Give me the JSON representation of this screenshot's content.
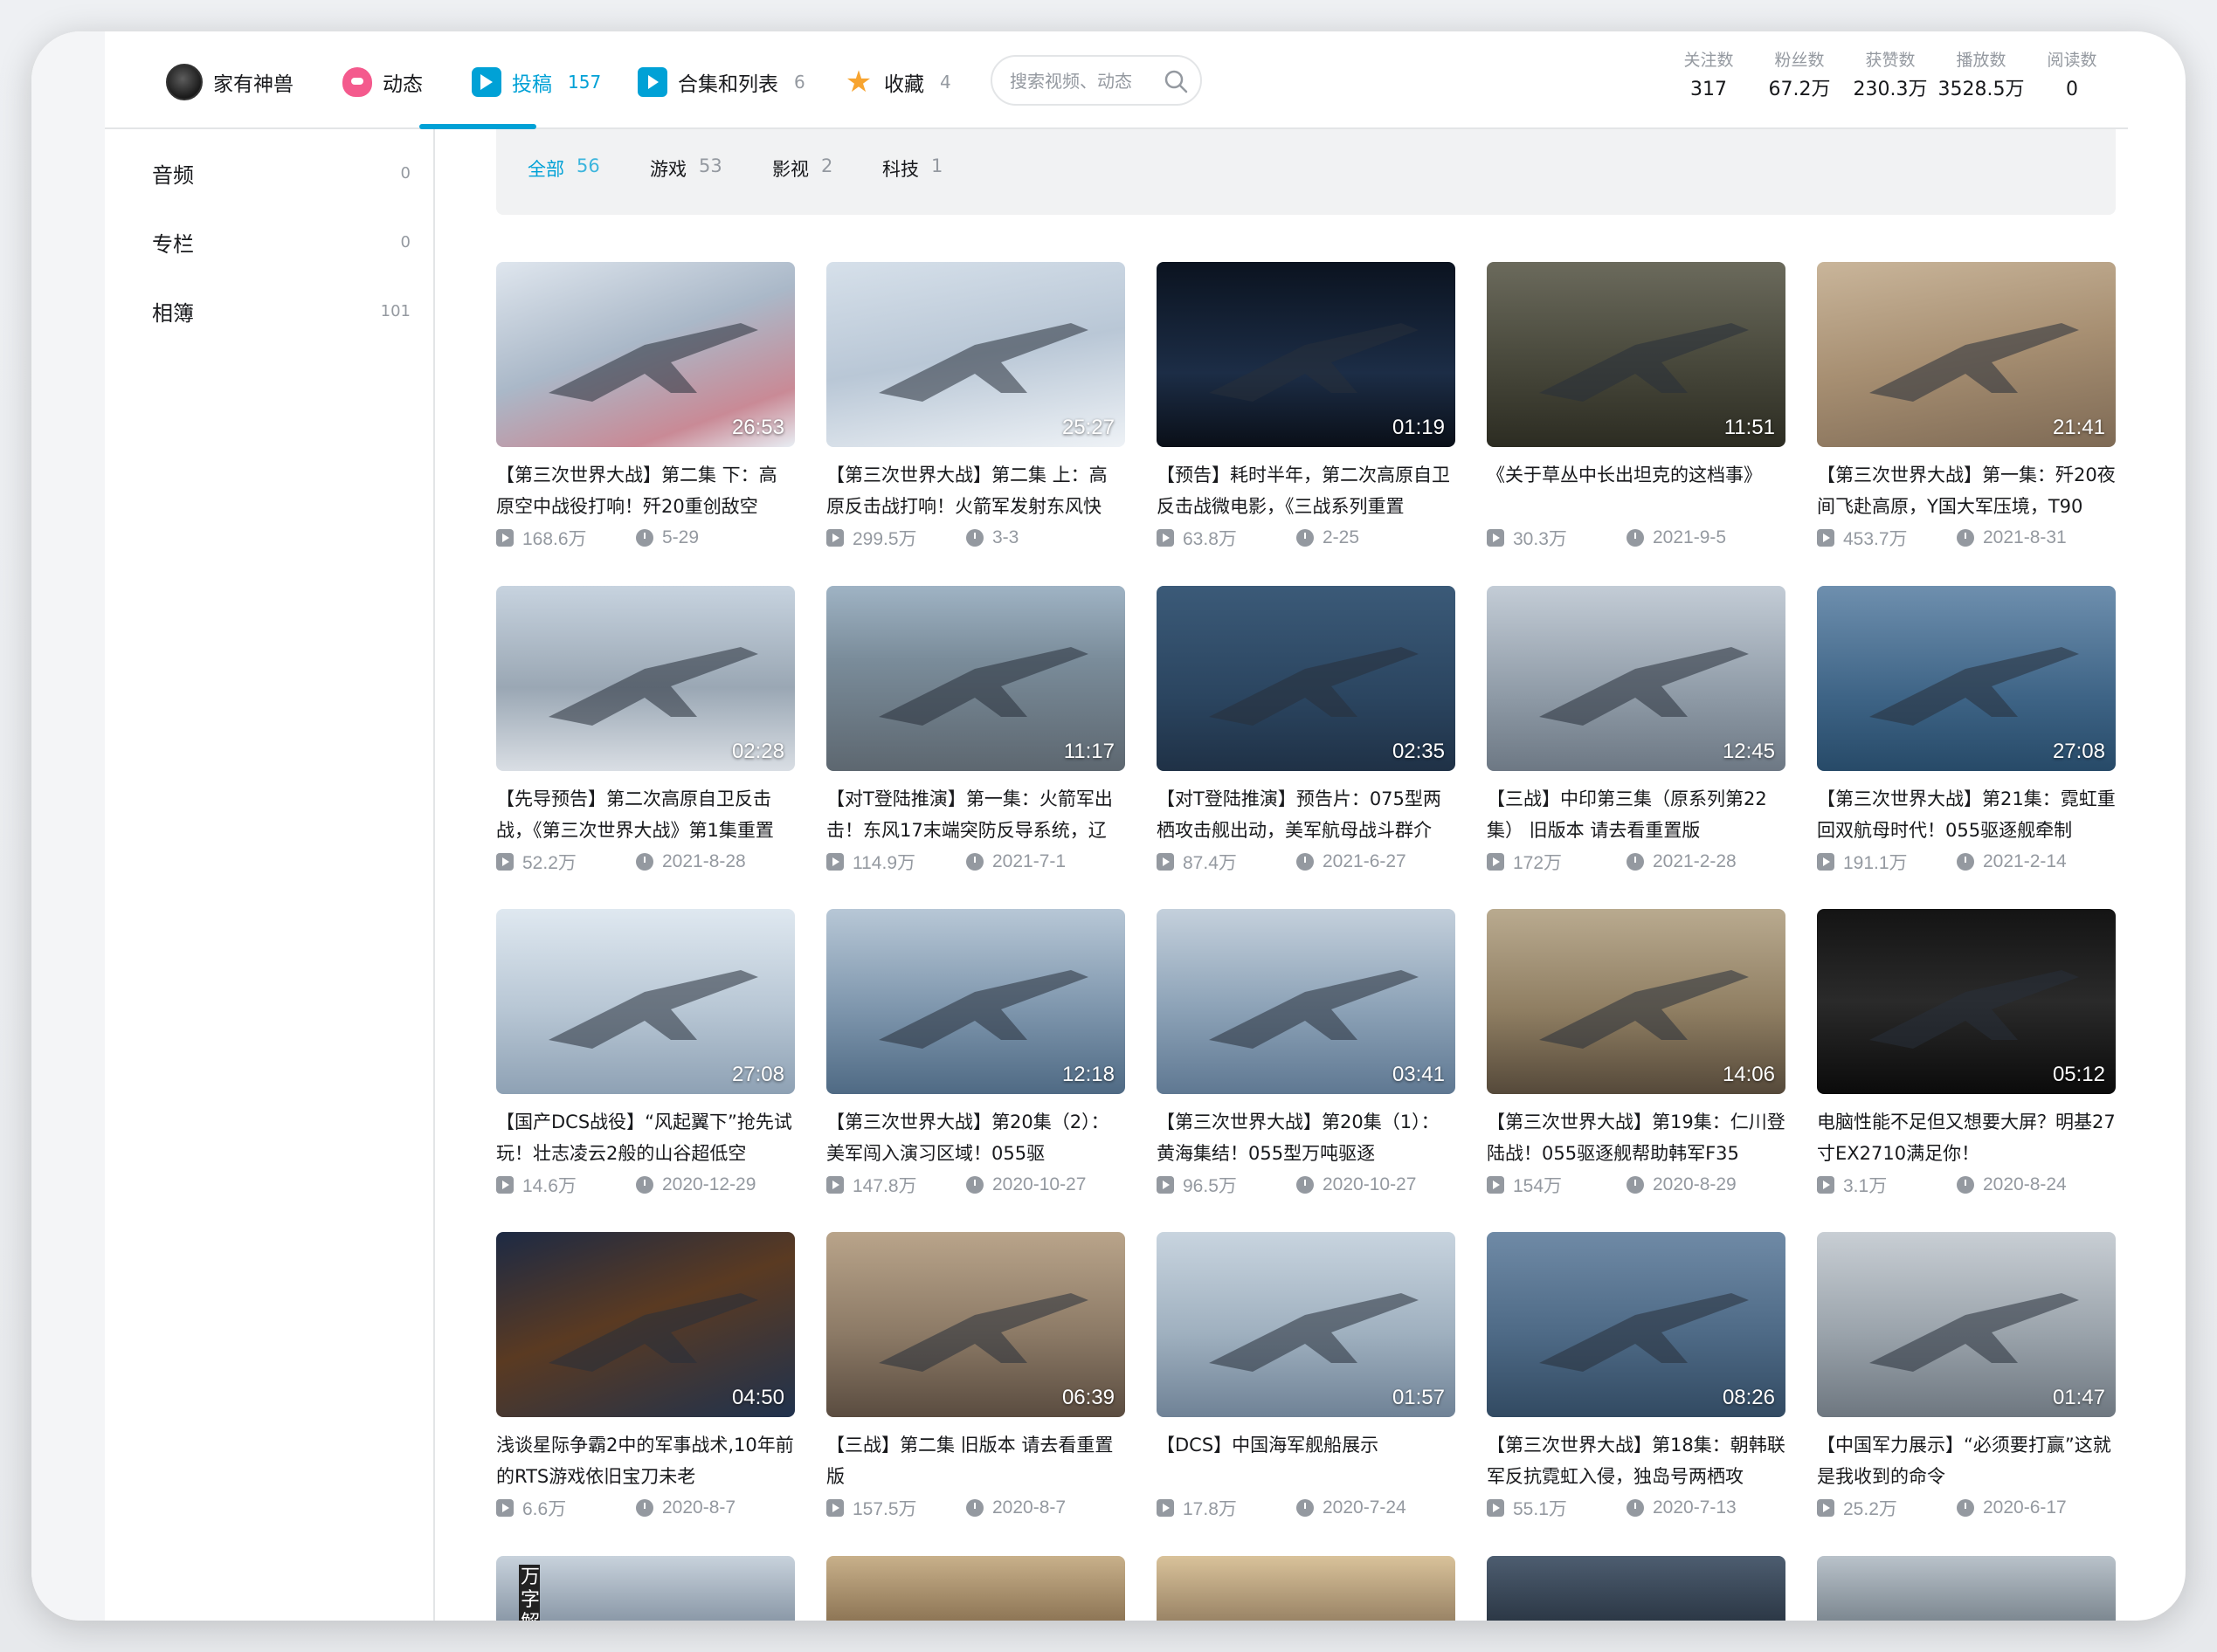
{
  "nav": {
    "username": "家有神兽",
    "items": [
      {
        "label": "动态",
        "count": ""
      },
      {
        "label": "投稿",
        "count": "157"
      },
      {
        "label": "合集和列表",
        "count": "6"
      },
      {
        "label": "收藏",
        "count": "4"
      }
    ],
    "search_placeholder": "搜索视频、动态"
  },
  "stats": [
    {
      "label": "关注数",
      "value": "317"
    },
    {
      "label": "粉丝数",
      "value": "67.2万"
    },
    {
      "label": "获赞数",
      "value": "230.3万"
    },
    {
      "label": "播放数",
      "value": "3528.5万"
    },
    {
      "label": "阅读数",
      "value": "0"
    }
  ],
  "sidebar": {
    "items": [
      {
        "label": "音频",
        "count": "0"
      },
      {
        "label": "专栏",
        "count": "0"
      },
      {
        "label": "相簿",
        "count": "101"
      }
    ]
  },
  "filters": [
    {
      "label": "全部",
      "count": "56"
    },
    {
      "label": "游戏",
      "count": "53"
    },
    {
      "label": "影视",
      "count": "2"
    },
    {
      "label": "科技",
      "count": "1"
    }
  ],
  "videos": [
    {
      "duration": "26:53",
      "title": "【第三次世界大战】第二集 下：高原空中战役打响！歼20重创敌空",
      "views": "168.6万",
      "date": "5-29"
    },
    {
      "duration": "25:27",
      "title": "【第三次世界大战】第二集 上：高原反击战打响！火箭军发射东风快",
      "views": "299.5万",
      "date": "3-3"
    },
    {
      "duration": "01:19",
      "title": "【预告】耗时半年，第二次高原自卫反击战微电影，《三战系列重置",
      "views": "63.8万",
      "date": "2-25"
    },
    {
      "duration": "11:51",
      "title": "《关于草丛中长出坦克的这档事》",
      "views": "30.3万",
      "date": "2021-9-5"
    },
    {
      "duration": "21:41",
      "title": "【第三次世界大战】第一集：歼20夜间飞赴高原，Y国大军压境，T90",
      "views": "453.7万",
      "date": "2021-8-31"
    },
    {
      "duration": "02:28",
      "title": "【先导预告】第二次高原自卫反击战，《第三次世界大战》第1集重置",
      "views": "52.2万",
      "date": "2021-8-28"
    },
    {
      "duration": "11:17",
      "title": "【对T登陆推演】第一集：火箭军出击！东风17末端突防反导系统，辽",
      "views": "114.9万",
      "date": "2021-7-1"
    },
    {
      "duration": "02:35",
      "title": "【对T登陆推演】预告片：075型两栖攻击舰出动，美军航母战斗群介",
      "views": "87.4万",
      "date": "2021-6-27"
    },
    {
      "duration": "12:45",
      "title": "【三战】中印第三集（原系列第22集） 旧版本 请去看重置版",
      "views": "172万",
      "date": "2021-2-28"
    },
    {
      "duration": "27:08",
      "title": "【第三次世界大战】第21集：霓虹重回双航母时代！055驱逐舰牵制",
      "views": "191.1万",
      "date": "2021-2-14"
    },
    {
      "duration": "27:08",
      "title": "【国产DCS战役】“风起翼下”抢先试玩！壮志凌云2般的山谷超低空",
      "views": "14.6万",
      "date": "2020-12-29"
    },
    {
      "duration": "12:18",
      "title": "【第三次世界大战】第20集（2）：美军闯入演习区域！055驱",
      "views": "147.8万",
      "date": "2020-10-27"
    },
    {
      "duration": "03:41",
      "title": "【第三次世界大战】第20集（1）：黄海集结！055型万吨驱逐",
      "views": "96.5万",
      "date": "2020-10-27"
    },
    {
      "duration": "14:06",
      "title": "【第三次世界大战】第19集：仁川登陆战！055驱逐舰帮助韩军F35",
      "views": "154万",
      "date": "2020-8-29"
    },
    {
      "duration": "05:12",
      "title": "电脑性能不足但又想要大屏？明基27寸EX2710满足你！",
      "views": "3.1万",
      "date": "2020-8-24"
    },
    {
      "duration": "04:50",
      "title": "浅谈星际争霸2中的军事战术,10年前的RTS游戏依旧宝刀未老",
      "views": "6.6万",
      "date": "2020-8-7"
    },
    {
      "duration": "06:39",
      "title": "【三战】第二集 旧版本 请去看重置版",
      "views": "157.5万",
      "date": "2020-8-7"
    },
    {
      "duration": "01:57",
      "title": "【DCS】中国海军舰船展示",
      "views": "17.8万",
      "date": "2020-7-24"
    },
    {
      "duration": "08:26",
      "title": "【第三次世界大战】第18集：朝韩联军反抗霓虹入侵，独岛号两栖攻",
      "views": "55.1万",
      "date": "2020-7-13"
    },
    {
      "duration": "01:47",
      "title": "【中国军力展示】“必须要打赢”这就是我收到的命令",
      "views": "25.2万",
      "date": "2020-6-17"
    }
  ],
  "partial_row_thumbs": [
    {
      "overlay_text": "万字解说"
    },
    {
      "overlay_text": ""
    },
    {
      "overlay_text": ""
    },
    {
      "overlay_text": ""
    },
    {
      "overlay_text": ""
    }
  ],
  "colors": {
    "accent": "#00a1d6",
    "muted": "#9499a0",
    "filterbar_bg": "#f1f2f3",
    "dynamic_icon": "#f45a8d",
    "fav_icon": "#f7a430"
  }
}
